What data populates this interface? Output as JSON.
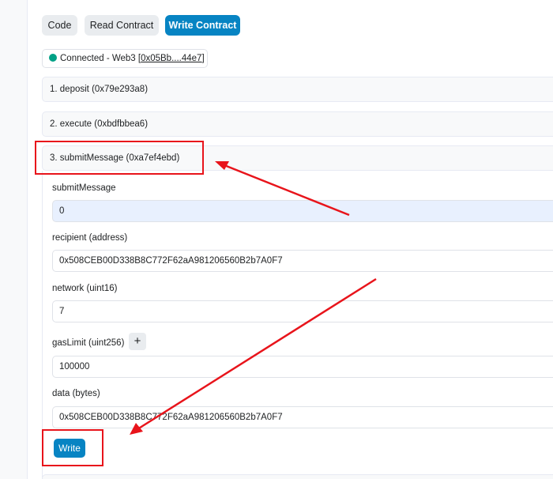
{
  "tabs": [
    {
      "label": "Code"
    },
    {
      "label": "Read Contract"
    },
    {
      "label": "Write Contract"
    }
  ],
  "connection": {
    "status_text": "Connected - Web3 [",
    "address": "0x05Bb....44e7",
    "close_bracket": "]"
  },
  "functions": [
    {
      "label": "1. deposit (0x79e293a8)"
    },
    {
      "label": "2. execute (0xbdfbbea6)"
    },
    {
      "label": "3. submitMessage (0xa7ef4ebd)"
    }
  ],
  "form": {
    "submitMessage": {
      "label": "submitMessage",
      "value": "0"
    },
    "recipient": {
      "label": "recipient (address)",
      "value": "0x508CEB00D338B8C772F62aA981206560B2b7A0F7"
    },
    "network": {
      "label": "network (uint16)",
      "value": "7"
    },
    "gasLimit": {
      "label": "gasLimit (uint256)",
      "value": "100000",
      "plus": "+"
    },
    "data": {
      "label": "data (bytes)",
      "value": "0x508CEB00D338B8C772F62aA981206560B2b7A0F7"
    },
    "write_label": "Write"
  },
  "colors": {
    "accent": "#0784c3",
    "connected": "#00a186",
    "annotation": "#e8141b"
  }
}
